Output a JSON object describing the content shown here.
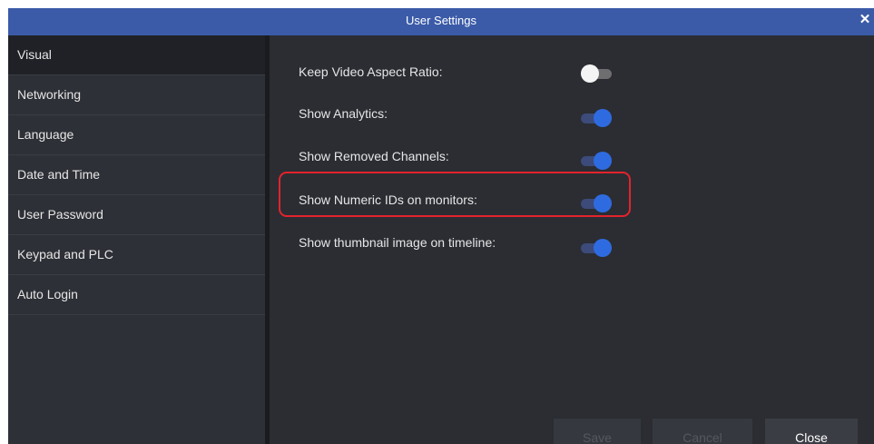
{
  "window": {
    "title": "User Settings",
    "close_icon": "close-icon"
  },
  "sidebar": {
    "items": [
      {
        "label": "Visual",
        "active": true
      },
      {
        "label": "Networking"
      },
      {
        "label": "Language"
      },
      {
        "label": "Date and Time"
      },
      {
        "label": "User Password"
      },
      {
        "label": "Keypad and PLC"
      },
      {
        "label": "Auto Login"
      }
    ]
  },
  "settings": [
    {
      "label": "Keep Video Aspect Ratio:",
      "enabled": false
    },
    {
      "label": "Show Analytics:",
      "enabled": true
    },
    {
      "label": "Show Removed Channels:",
      "enabled": true
    },
    {
      "label": "Show Numeric IDs on monitors:",
      "enabled": true,
      "highlighted": true
    },
    {
      "label": "Show thumbnail image on timeline:",
      "enabled": true
    }
  ],
  "buttons": {
    "save": {
      "label": "Save",
      "enabled": false
    },
    "cancel": {
      "label": "Cancel",
      "enabled": false
    },
    "close": {
      "label": "Close",
      "enabled": true
    }
  },
  "colors": {
    "title_bar": "#3b5ba8",
    "toggle_on": "#2f6be0",
    "highlight_outline": "#e3232c"
  }
}
